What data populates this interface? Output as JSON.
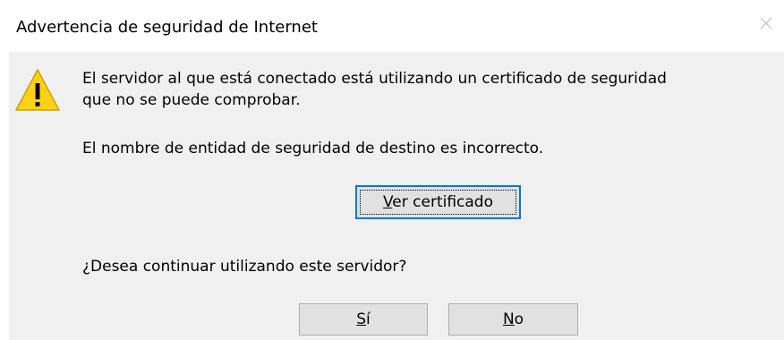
{
  "dialog": {
    "title": "Advertencia de seguridad de Internet",
    "message_line1": "El servidor al que está conectado está utilizando un certificado de seguridad",
    "message_line2": "que no se puede comprobar.",
    "detail": "El nombre de entidad de seguridad de destino es incorrecto.",
    "question": "¿Desea continuar utilizando este servidor?"
  },
  "buttons": {
    "view_certificate": {
      "accel": "V",
      "rest": "er certificado"
    },
    "yes": {
      "accel": "S",
      "rest": "í"
    },
    "no": {
      "accel": "N",
      "rest": "o"
    }
  },
  "colors": {
    "content_bg": "#f0f0f0",
    "button_bg": "#e1e1e1",
    "button_border": "#adadad",
    "focus_border": "#0078d7",
    "warning_fill": "#fcd116"
  },
  "icons": {
    "warning": "warning-triangle-icon",
    "close": "close-icon"
  }
}
